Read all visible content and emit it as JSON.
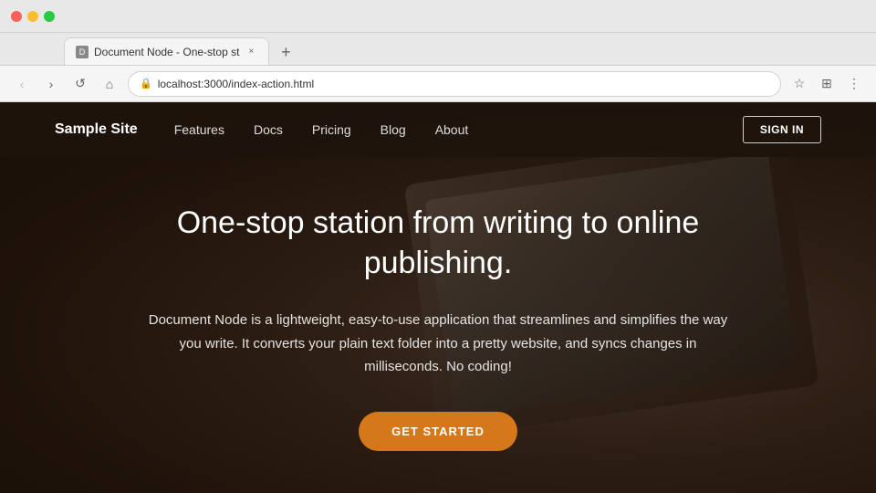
{
  "browser": {
    "titlebar": {
      "traffic_lights": [
        "red",
        "yellow",
        "green"
      ]
    },
    "tab": {
      "favicon_label": "D",
      "title": "Document Node - One-stop st",
      "close_label": "×"
    },
    "new_tab_label": "+",
    "toolbar": {
      "back_label": "‹",
      "forward_label": "›",
      "reload_label": "↺",
      "home_label": "⌂",
      "url": "localhost:3000/index-action.html",
      "bookmark_label": "☆",
      "extensions_label": "⊞",
      "menu_label": "⋮"
    }
  },
  "website": {
    "navbar": {
      "brand": "Sample Site",
      "links": [
        {
          "label": "Features"
        },
        {
          "label": "Docs"
        },
        {
          "label": "Pricing"
        },
        {
          "label": "Blog"
        },
        {
          "label": "About"
        }
      ],
      "signin_label": "SIGN IN"
    },
    "hero": {
      "title": "One-stop station from writing to online publishing.",
      "description": "Document Node is a lightweight, easy-to-use application that streamlines and simplifies the way you write. It converts your plain text folder into a pretty website, and syncs changes in milliseconds. No coding!",
      "cta_label": "GET STARTED"
    }
  }
}
